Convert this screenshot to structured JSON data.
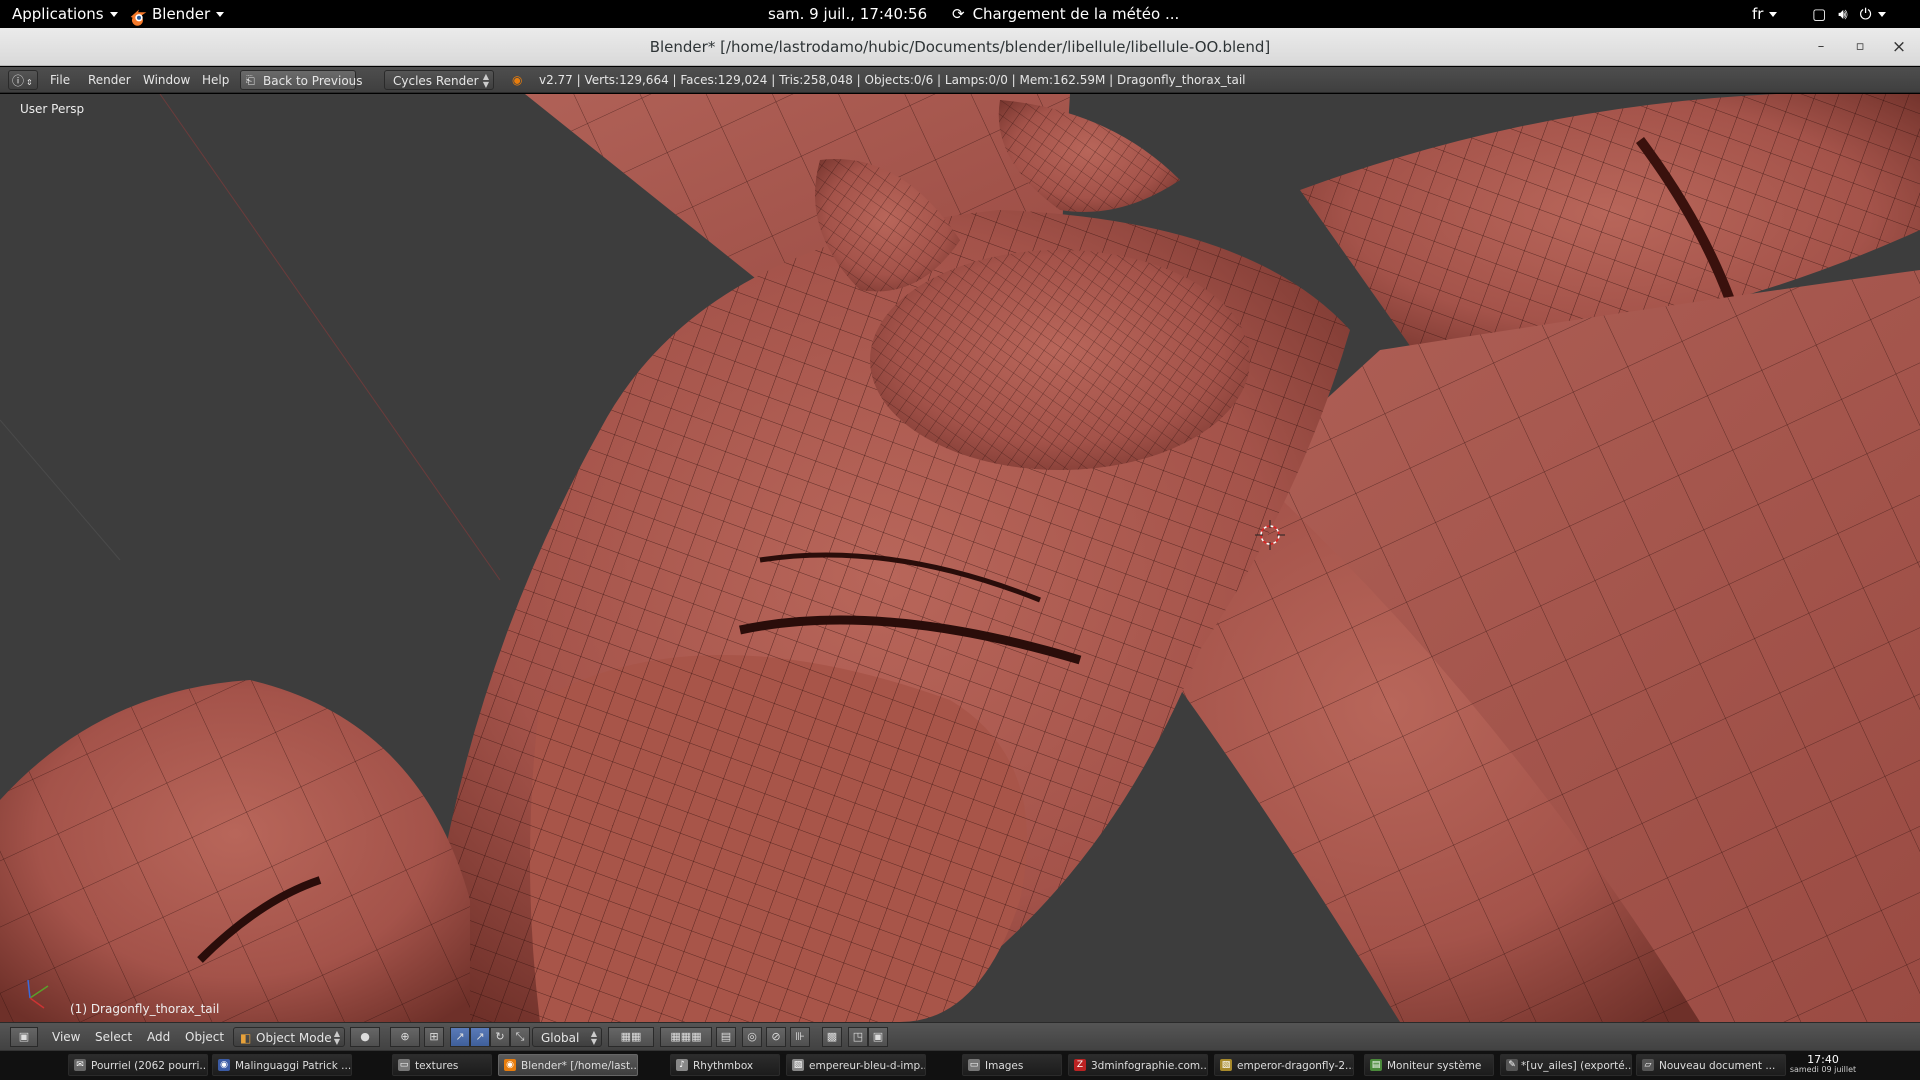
{
  "gnome_bar": {
    "applications": "Applications",
    "app_name": "Blender",
    "clock": "sam.  9 juil., 17:40:56",
    "weather": "Chargement de la météo ...",
    "lang": "fr"
  },
  "window": {
    "title": "Blender* [/home/lastrodamo/hubic/Documents/blender/libellule/libellule-OO.blend]",
    "minimize": "–",
    "maximize": "▫",
    "close": "×"
  },
  "info_header": {
    "menus": {
      "file": "File",
      "render": "Render",
      "window": "Window",
      "help": "Help"
    },
    "back_button": "Back to Previous",
    "render_engine": "Cycles Render",
    "stats": "v2.77 | Verts:129,664 | Faces:129,024 | Tris:258,048 | Objects:0/6 | Lamps:0/0 | Mem:162.59M | Dragonfly_thorax_tail"
  },
  "viewport": {
    "view_label": "User Persp",
    "object_label": "(1) Dragonfly_thorax_tail",
    "mesh_color": "#a4534a",
    "background_color": "#3d3d3d"
  },
  "view_header": {
    "menus": {
      "view": "View",
      "select": "Select",
      "add": "Add",
      "object": "Object"
    },
    "mode": "Object Mode",
    "orientation": "Global"
  },
  "taskbar": {
    "items": [
      {
        "label": "Pourriel (2062 pourri...",
        "icon": "mail-icon",
        "color": "#666"
      },
      {
        "label": "Malinguaggi Patrick ...",
        "icon": "browser-icon",
        "color": "#3b5ba5"
      },
      {
        "label": "textures",
        "icon": "folder-icon",
        "color": "#777"
      },
      {
        "label": "Blender* [/home/last...",
        "icon": "blender-icon",
        "color": "#e87d0d"
      },
      {
        "label": "Rhythmbox",
        "icon": "music-icon",
        "color": "#888"
      },
      {
        "label": "empereur-bleu-d-imp...",
        "icon": "image-icon",
        "color": "#888"
      },
      {
        "label": "Images",
        "icon": "folder-icon",
        "color": "#777"
      },
      {
        "label": "3dminfographie.com...",
        "icon": "filezilla-icon",
        "color": "#b22"
      },
      {
        "label": "emperor-dragonfly-2...",
        "icon": "image-icon",
        "color": "#a88a2a"
      },
      {
        "label": "Moniteur système",
        "icon": "monitor-icon",
        "color": "#4a8a3a"
      },
      {
        "label": "*[uv_ailes] (exporté...",
        "icon": "gimp-icon",
        "color": "#555"
      },
      {
        "label": "Nouveau document ...",
        "icon": "editor-icon",
        "color": "#555"
      }
    ],
    "clock_time": "17:40",
    "clock_date": "samedi 09 juillet"
  }
}
